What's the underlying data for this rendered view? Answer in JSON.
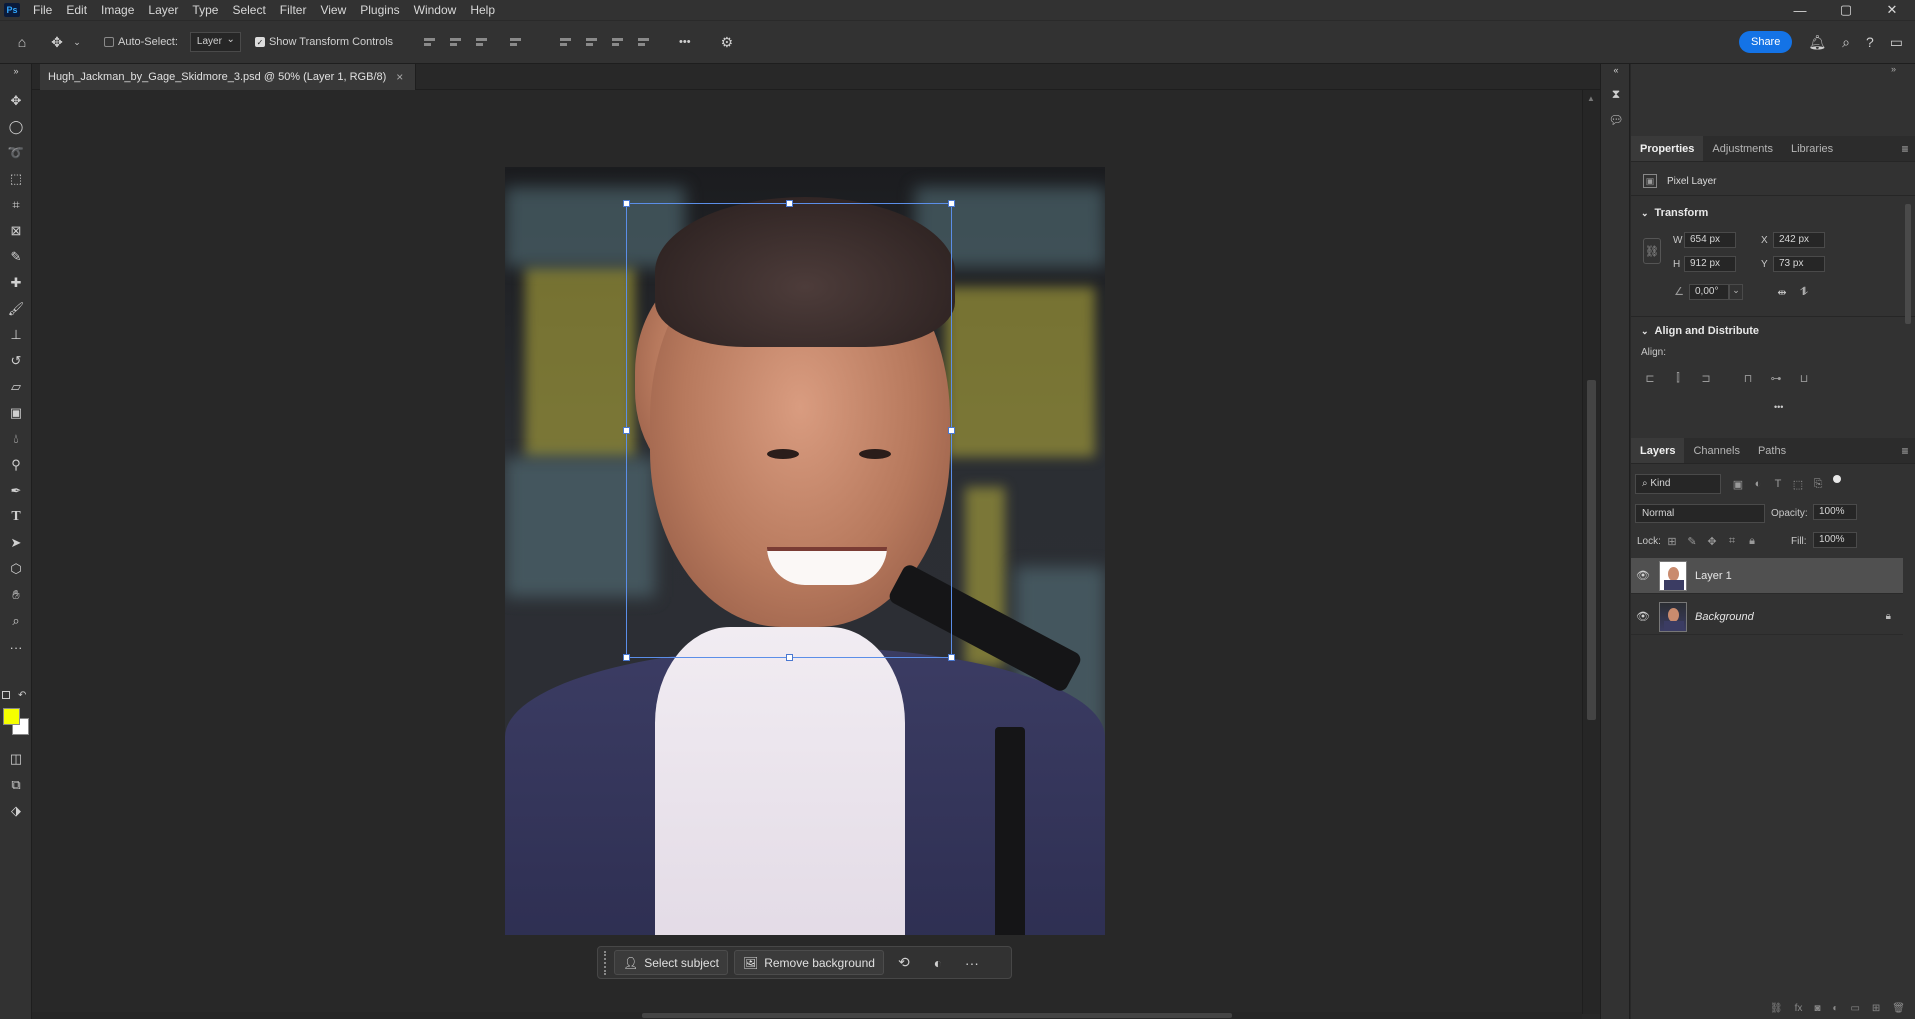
{
  "app": {
    "logo": "Ps",
    "menu": [
      "File",
      "Edit",
      "Image",
      "Layer",
      "Type",
      "Select",
      "Filter",
      "View",
      "Plugins",
      "Window",
      "Help"
    ],
    "window_controls": {
      "minimize": "—",
      "restore": "▢",
      "close": "✕"
    }
  },
  "options": {
    "auto_select_label": "Auto-Select:",
    "auto_select_checked": false,
    "target_select": "Layer",
    "show_transform_label": "Show Transform Controls",
    "show_transform_checked": true,
    "more": "•••",
    "share_label": "Share"
  },
  "document": {
    "tab_title": "Hugh_Jackman_by_Gage_Skidmore_3.psd @ 50% (Layer 1, RGB/8)",
    "close": "×"
  },
  "toolbar": {
    "tools": [
      "move-tool",
      "marquee-tool",
      "lasso-tool",
      "object-select-tool",
      "crop-tool",
      "frame-tool",
      "eyedropper-tool",
      "healing-brush-tool",
      "brush-tool",
      "clone-stamp-tool",
      "history-brush-tool",
      "eraser-tool",
      "gradient-tool",
      "blur-tool",
      "dodge-tool",
      "pen-tool",
      "type-tool",
      "path-select-tool",
      "shape-tool",
      "hand-tool",
      "zoom-tool",
      "more-tools"
    ],
    "foreground_color": "#f5ff00",
    "background_color": "#ffffff",
    "type_tool_glyph": "T"
  },
  "contextual_bar": {
    "select_subject": "Select subject",
    "remove_background": "Remove background"
  },
  "properties": {
    "tabs": [
      "Properties",
      "Adjustments",
      "Libraries"
    ],
    "layer_type": "Pixel Layer",
    "transform_title": "Transform",
    "w_label": "W",
    "w_value": "654 px",
    "h_label": "H",
    "h_value": "912 px",
    "x_label": "X",
    "x_value": "242 px",
    "y_label": "Y",
    "y_value": "73 px",
    "angle": "0,00°",
    "align_title": "Align and Distribute",
    "align_label": "Align:",
    "more": "•••"
  },
  "layers_panel": {
    "tabs": [
      "Layers",
      "Channels",
      "Paths"
    ],
    "kind_label": "Kind",
    "blend_mode": "Normal",
    "opacity_label": "Opacity:",
    "opacity_value": "100%",
    "lock_label": "Lock:",
    "fill_label": "Fill:",
    "fill_value": "100%",
    "layers": [
      {
        "name": "Layer 1",
        "selected": true,
        "locked": false
      },
      {
        "name": "Background",
        "selected": false,
        "locked": true
      }
    ]
  },
  "colors": {
    "accent": "#1473e6",
    "panel_bg": "#323232",
    "canvas_bg": "#282828",
    "selection": "#5b8ee8"
  }
}
